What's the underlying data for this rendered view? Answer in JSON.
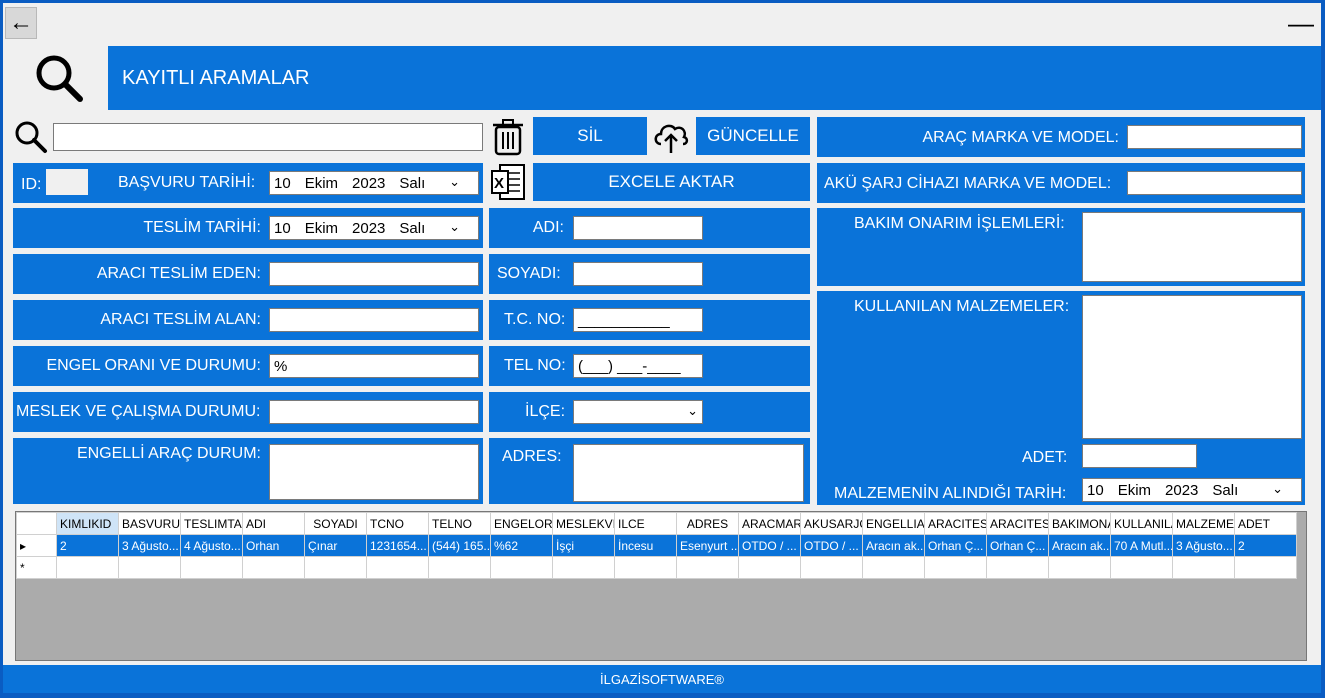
{
  "window": {
    "minimize_label": "—",
    "back_label": "←"
  },
  "header": {
    "title": "KAYITLI ARAMALAR"
  },
  "search": {
    "value": ""
  },
  "buttons": {
    "sil": "SİL",
    "guncelle": "GÜNCELLE",
    "excel": "EXCELE AKTAR"
  },
  "form": {
    "id_label": "ID:",
    "basvuru_label": "BAŞVURU TARİHİ:",
    "basvuru_date": {
      "day": "10",
      "month": "Ekim",
      "year": "2023",
      "weekday": "Salı"
    },
    "teslim_label": "TESLİM TARİHİ:",
    "teslim_date": {
      "day": "10",
      "month": "Ekim",
      "year": "2023",
      "weekday": "Salı"
    },
    "teslim_eden_label": "ARACI TESLİM EDEN:",
    "teslim_alan_label": "ARACI TESLİM ALAN:",
    "engel_label": "ENGEL ORANI VE DURUMU:",
    "engel_value": "%",
    "meslek_label": "MESLEK VE ÇALIŞMA DURUMU:",
    "engelli_arac_label": "ENGELLİ ARAÇ DURUM:",
    "adi_label": "ADI:",
    "soyadi_label": "SOYADI:",
    "tc_label": "T.C. NO:",
    "tc_mask": "___________",
    "tel_label": "TEL NO:",
    "tel_mask": "(___) ___-____",
    "ilce_label": "İLÇE:",
    "adres_label": "ADRES:",
    "arac_marka_label": "ARAÇ  MARKA VE MODEL:",
    "aku_label": "AKÜ ŞARJ CİHAZI  MARKA VE MODEL:",
    "bakim_label": "BAKIM ONARIM İŞLEMLERİ:",
    "malzemeler_label": "KULLANILAN MALZEMELER:",
    "adet_label": "ADET:",
    "malzeme_tarih_label": "MALZEMENİN ALINDIĞI TARİH:",
    "malzeme_date": {
      "day": "10",
      "month": "Ekim",
      "year": "2023",
      "weekday": "Salı"
    }
  },
  "table": {
    "columns": [
      "KIMLIKID",
      "BASVURU",
      "TESLIMTA",
      "ADI",
      "SOYADI",
      "TCNO",
      "TELNO",
      "ENGELOR",
      "MESLEKVE",
      "ILCE",
      "ADRES",
      "ARACMAR",
      "AKUSARJC",
      "ENGELLIAI",
      "ARACITES",
      "ARACITES",
      "BAKIMONA",
      "KULLANILA",
      "MALZEMEI",
      "ADET"
    ],
    "rows": [
      [
        "2",
        "3 Ağusto...",
        "4 Ağusto...",
        "Orhan",
        "Çınar",
        "1231654...",
        "(544) 165...",
        "%62",
        "İşçi",
        "İncesu",
        "Esenyurt ...",
        "OTDO / ...",
        "OTDO / ...",
        "Aracın ak...",
        "Orhan Ç...",
        "Orhan Ç...",
        "Aracın ak...",
        "70 A Mutl...",
        "3 Ağusto...",
        "2"
      ]
    ],
    "selected_marker": "▸",
    "new_row_marker": "*"
  },
  "footer": {
    "text": "İLGAZİSOFTWARE®"
  }
}
